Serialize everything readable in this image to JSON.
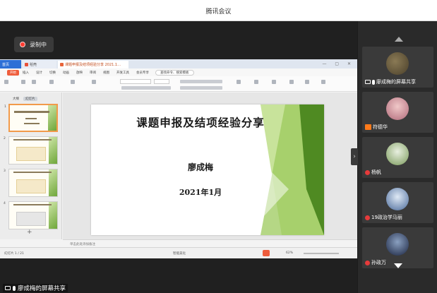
{
  "app": {
    "title": "腾讯会议",
    "recording_label": "录制中",
    "share_label": "廖成梅的屏幕共享"
  },
  "wps": {
    "tabs": [
      {
        "label": "首页"
      },
      {
        "label": "稻壳"
      },
      {
        "label": "课题申报及结项经验分享 2021.1…"
      }
    ],
    "menu": [
      "开始",
      "插入",
      "设计",
      "切换",
      "动画",
      "放映",
      "审阅",
      "视图",
      "开发工具",
      "会员专享"
    ],
    "active_menu": "开始",
    "search_label": "查找命令、搜索模板",
    "panel_tabs": [
      "大纲",
      "幻灯片"
    ],
    "slide_numbers": [
      "1",
      "2",
      "3",
      "4"
    ],
    "notes_placeholder": "单击此处添加备注",
    "status_left": "幻灯片 1 / 21",
    "status_mid": "智能美化",
    "zoom": "62%"
  },
  "slide": {
    "title": "课题申报及结项经验分享",
    "author": "廖成梅",
    "date": "2021年1月",
    "accent_colors": [
      "#c8e39b",
      "#7fb23a",
      "#4f8a22"
    ]
  },
  "participants": [
    {
      "name": "廖成梅的屏幕共享",
      "avatar_color": "#6b5a3a"
    },
    {
      "name": "符德华",
      "avatar_color": "#c98a8a"
    },
    {
      "name": "杨帆",
      "avatar_color": "#8fa86a"
    },
    {
      "name": "19政治学马丽",
      "avatar_color": "#4a6a9a"
    },
    {
      "name": "孙政万",
      "avatar_color": "#2a3a5a"
    }
  ]
}
